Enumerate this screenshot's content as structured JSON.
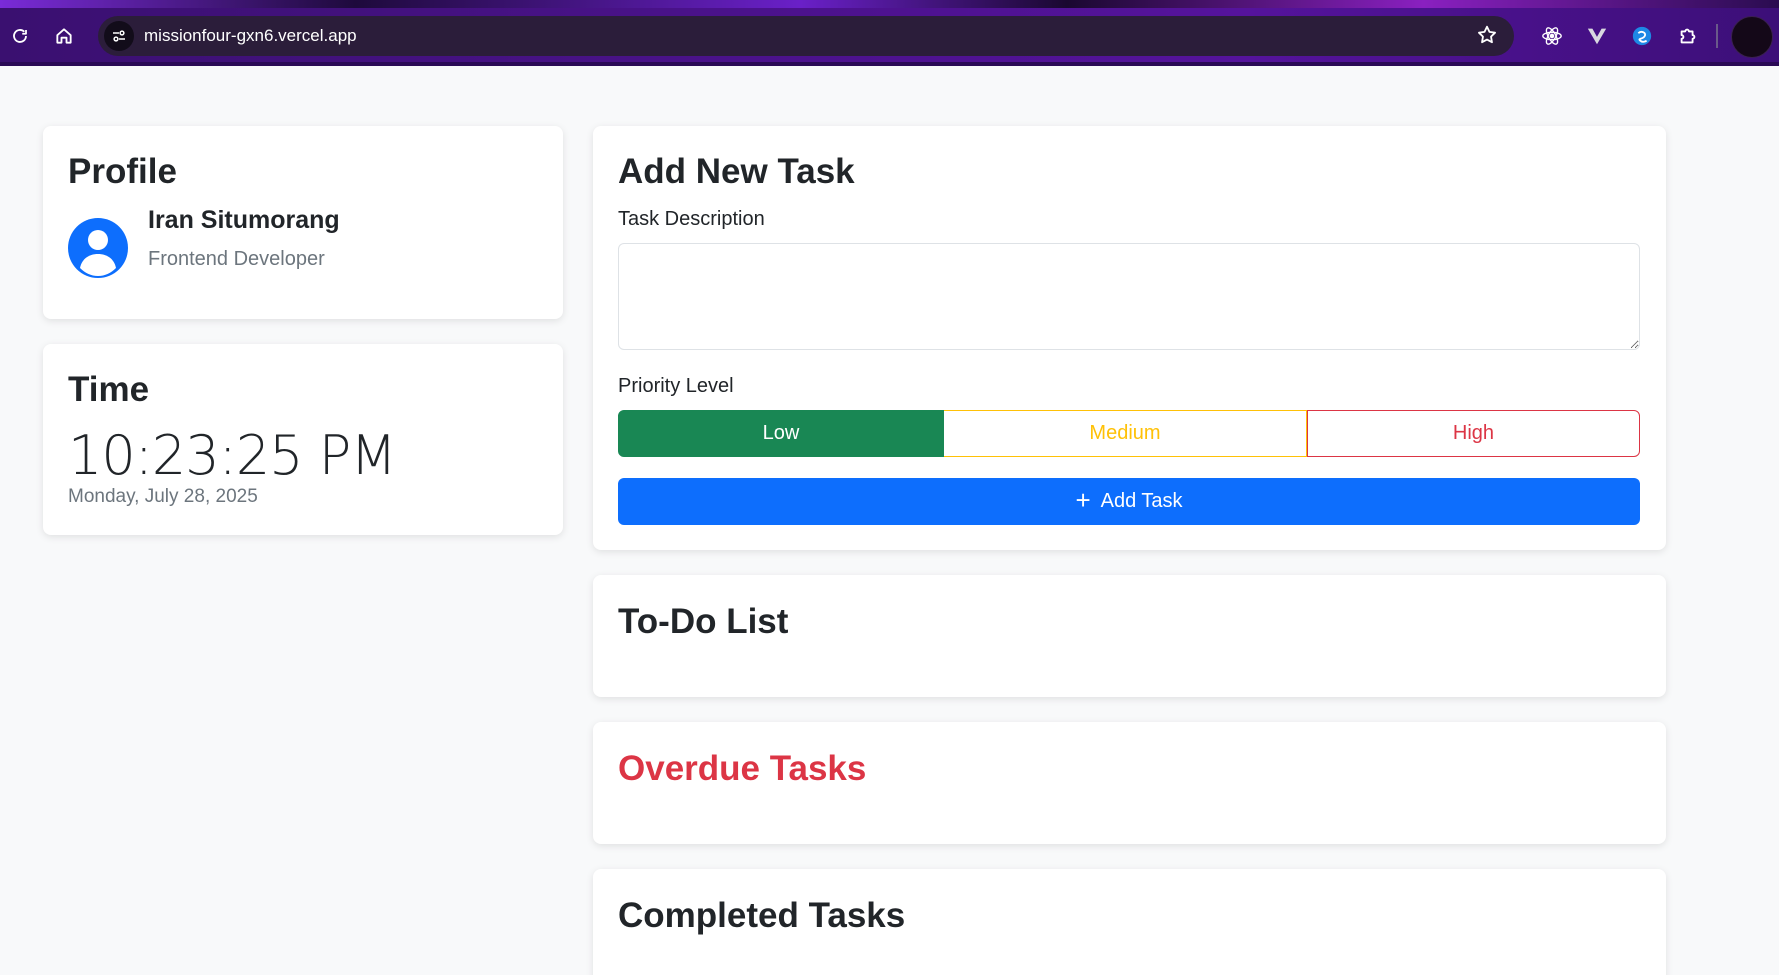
{
  "browser": {
    "url": "missionfour-gxn6.vercel.app",
    "icons": [
      "reload-icon",
      "home-icon",
      "site-info-icon",
      "bookmark-star-icon",
      "react-devtools-icon",
      "vue-devtools-icon",
      "extension-blue-icon",
      "extensions-puzzle-icon",
      "profile-avatar"
    ]
  },
  "profile": {
    "title": "Profile",
    "name": "Iran Situmorang",
    "role": "Frontend Developer"
  },
  "time": {
    "title": "Time",
    "clock": "10:23:25 PM",
    "date": "Monday, July 28, 2025"
  },
  "add_task": {
    "title": "Add New Task",
    "description_label": "Task Description",
    "description_value": "",
    "priority_label": "Priority Level",
    "priorities": [
      "Low",
      "Medium",
      "High"
    ],
    "selected_priority": "Low",
    "button_label": "Add Task"
  },
  "lists": {
    "todo_title": "To-Do List",
    "overdue_title": "Overdue Tasks",
    "completed_title": "Completed Tasks"
  },
  "colors": {
    "primary": "#0d6efd",
    "success": "#198754",
    "warning": "#ffc107",
    "danger": "#dc3545",
    "muted": "#6c757d"
  }
}
